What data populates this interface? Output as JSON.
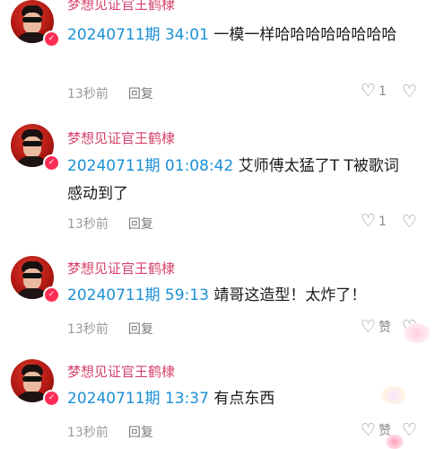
{
  "comments": [
    {
      "username": "梦想见证官王鹤棣",
      "timestamp": "20240711期 34:01",
      "text": " 一模一样哈哈哈哈哈哈哈哈",
      "time_ago": "13秒前",
      "reply": "回复",
      "likes": "1"
    },
    {
      "username": "梦想见证官王鹤棣",
      "timestamp": "20240711期 01:08:42",
      "text": " 艾师傅太猛了T T被歌词感动到了",
      "time_ago": "13秒前",
      "reply": "回复",
      "likes": "1"
    },
    {
      "username": "梦想见证官王鹤棣",
      "timestamp": "20240711期 59:13",
      "text": " 靖哥这造型！太炸了！",
      "time_ago": "13秒前",
      "reply": "回复",
      "likes": "赞"
    },
    {
      "username": "梦想见证官王鹤棣",
      "timestamp": "20240711期 13:37",
      "text": " 有点东西",
      "time_ago": "13秒前",
      "reply": "回复",
      "likes": "赞"
    }
  ],
  "icons": {
    "like": "heart-outline-icon",
    "dislike": "broken-heart-icon",
    "verified": "verified-badge-icon"
  }
}
